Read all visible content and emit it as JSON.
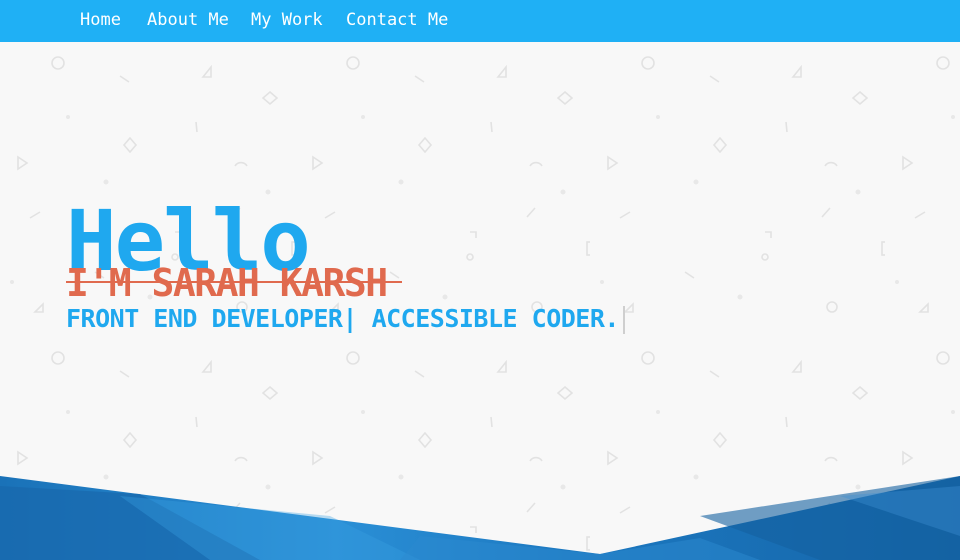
{
  "nav": {
    "items": [
      {
        "label": "Home"
      },
      {
        "label": "About Me"
      },
      {
        "label": "My Work"
      },
      {
        "label": "Contact Me"
      }
    ]
  },
  "hero": {
    "greeting": "Hello",
    "name": "I'M SARAH KARSH",
    "tagline": "FRONT END DEVELOPER| ACCESSIBLE CODER."
  },
  "colors": {
    "nav_bg": "#1fb0f5",
    "greeting": "#1fa8ef",
    "name": "#e06a4e",
    "tagline": "#1fa8ef",
    "page_bg": "#f8f8f8",
    "band_dark": "#1565a8",
    "band_light": "#2a8fd6"
  }
}
